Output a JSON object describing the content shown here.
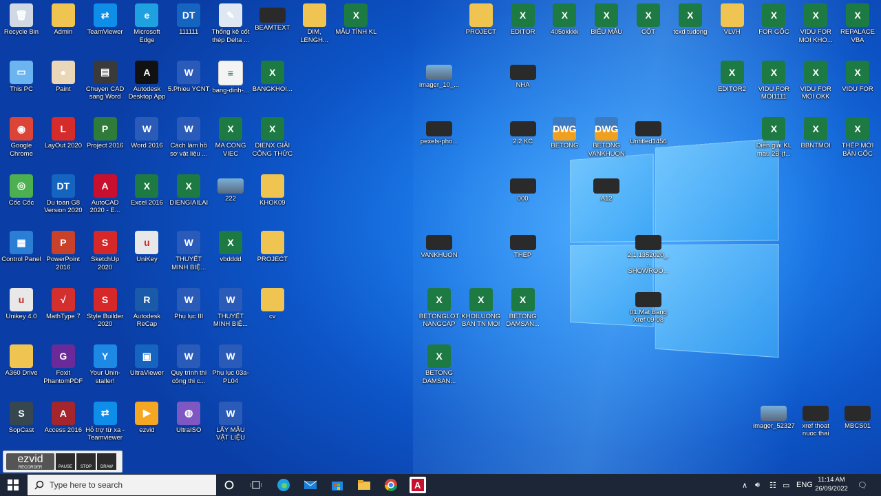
{
  "desktop": {
    "icons": [
      {
        "label": "Recycle Bin",
        "icon": "recycle-bin-icon",
        "col": 0,
        "row": 0
      },
      {
        "label": "Admin",
        "icon": "user-folder-icon",
        "col": 1,
        "row": 0
      },
      {
        "label": "TeamViewer",
        "icon": "teamviewer-icon",
        "col": 2,
        "row": 0
      },
      {
        "label": "Microsoft Edge",
        "icon": "edge-icon",
        "col": 3,
        "row": 0
      },
      {
        "label": "111111",
        "icon": "dutoan-icon",
        "col": 4,
        "row": 0
      },
      {
        "label": "Thống kê cốt thép Delta ...",
        "icon": "pencil-icon",
        "col": 5,
        "row": 0
      },
      {
        "label": "BEAMTEXT",
        "icon": "image-icon",
        "col": 6,
        "row": 0
      },
      {
        "label": "DIM, LENGH...",
        "icon": "text-file-icon",
        "col": 7,
        "row": 0
      },
      {
        "label": "MẪU TÍNH KL",
        "icon": "excel-icon",
        "col": 8,
        "row": 0
      },
      {
        "label": "This PC",
        "icon": "this-pc-icon",
        "col": 0,
        "row": 1
      },
      {
        "label": "Paint",
        "icon": "paint-icon",
        "col": 1,
        "row": 1
      },
      {
        "label": "Chuyen CAD sang Word",
        "icon": "clipboard-icon",
        "col": 2,
        "row": 1
      },
      {
        "label": "Autodesk Desktop App",
        "icon": "autodesk-icon",
        "col": 3,
        "row": 1
      },
      {
        "label": "5.Phieu YCNT",
        "icon": "word-icon",
        "col": 4,
        "row": 1
      },
      {
        "label": "bang-dinh-...",
        "icon": "doc-icon",
        "col": 5,
        "row": 1
      },
      {
        "label": "BANGKHOI...",
        "icon": "excel-icon",
        "col": 6,
        "row": 1
      },
      {
        "label": "Google Chrome",
        "icon": "chrome-icon",
        "col": 0,
        "row": 2
      },
      {
        "label": "LayOut 2020",
        "icon": "layout-icon",
        "col": 1,
        "row": 2
      },
      {
        "label": "Project 2016",
        "icon": "project-icon",
        "col": 2,
        "row": 2
      },
      {
        "label": "Word 2016",
        "icon": "word-icon",
        "col": 3,
        "row": 2
      },
      {
        "label": "Cách làm hồ sơ vật liệu ...",
        "icon": "word-icon",
        "col": 4,
        "row": 2
      },
      {
        "label": "MA CONG VIEC",
        "icon": "excel-icon",
        "col": 5,
        "row": 2
      },
      {
        "label": "DIENX GIẢI CÔNG THỨC",
        "icon": "excel-icon",
        "col": 6,
        "row": 2
      },
      {
        "label": "Cốc Cốc",
        "icon": "coccoc-icon",
        "col": 0,
        "row": 3
      },
      {
        "label": "Du toan G8 Version 2020",
        "icon": "dutoan-icon",
        "col": 1,
        "row": 3
      },
      {
        "label": "AutoCAD 2020 - E...",
        "icon": "autocad-icon",
        "col": 2,
        "row": 3
      },
      {
        "label": "Excel 2016",
        "icon": "excel-icon",
        "col": 3,
        "row": 3
      },
      {
        "label": "DIENGIAILAI",
        "icon": "excel-icon",
        "col": 4,
        "row": 3
      },
      {
        "label": "222",
        "icon": "image-icon",
        "col": 5,
        "row": 3
      },
      {
        "label": "KHOK09",
        "icon": "archive-icon",
        "col": 6,
        "row": 3
      },
      {
        "label": "Control Panel",
        "icon": "control-panel-icon",
        "col": 0,
        "row": 4
      },
      {
        "label": "PowerPoint 2016",
        "icon": "powerpoint-icon",
        "col": 1,
        "row": 4
      },
      {
        "label": "SketchUp 2020",
        "icon": "sketchup-icon",
        "col": 2,
        "row": 4
      },
      {
        "label": "UniKey",
        "icon": "unikey-icon",
        "col": 3,
        "row": 4
      },
      {
        "label": "THUYẾT MINH BIỆ...",
        "icon": "word-icon",
        "col": 4,
        "row": 4
      },
      {
        "label": "vbdddd",
        "icon": "excel-icon",
        "col": 5,
        "row": 4
      },
      {
        "label": "PROJECT",
        "icon": "archive-icon",
        "col": 6,
        "row": 4
      },
      {
        "label": "Unikey 4.0",
        "icon": "unikey-icon",
        "col": 0,
        "row": 5
      },
      {
        "label": "MathType 7",
        "icon": "mathtype-icon",
        "col": 1,
        "row": 5
      },
      {
        "label": "Style Builder 2020",
        "icon": "sketchup-icon",
        "col": 2,
        "row": 5
      },
      {
        "label": "Autodesk ReCap",
        "icon": "recap-icon",
        "col": 3,
        "row": 5
      },
      {
        "label": "Phụ lục III",
        "icon": "word-icon",
        "col": 4,
        "row": 5
      },
      {
        "label": "THUYẾT MINH BIỆ...",
        "icon": "word-icon",
        "col": 5,
        "row": 5
      },
      {
        "label": "cv",
        "icon": "folder-icon",
        "col": 6,
        "row": 5
      },
      {
        "label": "A360 Drive",
        "icon": "folder-icon",
        "col": 0,
        "row": 6
      },
      {
        "label": "Foxit PhantomPDF",
        "icon": "foxit-icon",
        "col": 1,
        "row": 6
      },
      {
        "label": "Your Unin-staller!",
        "icon": "uninstaller-icon",
        "col": 2,
        "row": 6
      },
      {
        "label": "UltraViewer",
        "icon": "ultraviewer-icon",
        "col": 3,
        "row": 6
      },
      {
        "label": "Quy trình thi công thi c...",
        "icon": "word-icon",
        "col": 4,
        "row": 6
      },
      {
        "label": "Phụ lục 03a-PL04",
        "icon": "word-icon",
        "col": 5,
        "row": 6
      },
      {
        "label": "SopCast",
        "icon": "sopcast-icon",
        "col": 0,
        "row": 7
      },
      {
        "label": "Access 2016",
        "icon": "access-icon",
        "col": 1,
        "row": 7
      },
      {
        "label": "Hỗ trợ từ xa - Teamviewer",
        "icon": "teamviewer-icon",
        "col": 2,
        "row": 7
      },
      {
        "label": "ezvid",
        "icon": "ezvid-icon",
        "col": 3,
        "row": 7
      },
      {
        "label": "UltraISO",
        "icon": "disc-icon",
        "col": 4,
        "row": 7
      },
      {
        "label": "LẤY MẪU VẬT LIỆU",
        "icon": "word-icon",
        "col": 5,
        "row": 7
      },
      {
        "label": "imager_10_...",
        "icon": "image-icon",
        "col": 10,
        "row": 1
      },
      {
        "label": "pexels-pho...",
        "icon": "image-icon",
        "col": 10,
        "row": 2
      },
      {
        "label": "VANKHUON",
        "icon": "image-icon",
        "col": 10,
        "row": 4
      },
      {
        "label": "BETONGLOT NANGCAP",
        "icon": "excel-icon",
        "col": 10,
        "row": 5
      },
      {
        "label": "BETONG DAMSAN...",
        "icon": "excel-icon",
        "col": 10,
        "row": 6
      },
      {
        "label": "KHOILUONG BAN TN MOI",
        "icon": "excel-icon",
        "col": 11,
        "row": 5
      },
      {
        "label": "PROJECT",
        "icon": "archive-icon",
        "col": 11,
        "row": 0
      },
      {
        "label": "EDITOR",
        "icon": "excel-icon",
        "col": 12,
        "row": 0
      },
      {
        "label": "NHA",
        "icon": "image-icon",
        "col": 12,
        "row": 1
      },
      {
        "label": "2.2 KC",
        "icon": "image-icon",
        "col": 12,
        "row": 2
      },
      {
        "label": "000",
        "icon": "image-icon",
        "col": 12,
        "row": 3
      },
      {
        "label": "THEP",
        "icon": "image-icon",
        "col": 12,
        "row": 4
      },
      {
        "label": "BETONG DAMSAN...",
        "icon": "excel-icon",
        "col": 12,
        "row": 5
      },
      {
        "label": "405okkkk",
        "icon": "excel-icon",
        "col": 13,
        "row": 0
      },
      {
        "label": "BETONG",
        "icon": "dwg-icon",
        "col": 13,
        "row": 2
      },
      {
        "label": "BIỂU MẪU",
        "icon": "excel-icon",
        "col": 14,
        "row": 0
      },
      {
        "label": "BETONG VANKHUON",
        "icon": "dwg-icon",
        "col": 14,
        "row": 2
      },
      {
        "label": "A12",
        "icon": "image-icon",
        "col": 14,
        "row": 3
      },
      {
        "label": "CỘT",
        "icon": "excel-icon",
        "col": 15,
        "row": 0
      },
      {
        "label": "Untitled1456",
        "icon": "image-icon",
        "col": 15,
        "row": 2
      },
      {
        "label": "2.1.1352020_... SHOWROO...",
        "icon": "image-icon",
        "col": 15,
        "row": 4
      },
      {
        "label": "01.Mat Bang Xref 09-08",
        "icon": "image-icon",
        "col": 15,
        "row": 5
      },
      {
        "label": "tcxd tudong",
        "icon": "excel-icon",
        "col": 16,
        "row": 0
      },
      {
        "label": "VLVH",
        "icon": "text-file-icon",
        "col": 17,
        "row": 0
      },
      {
        "label": "EDITOR2",
        "icon": "excel-icon",
        "col": 17,
        "row": 1
      },
      {
        "label": "FOR GỐC",
        "icon": "excel-icon",
        "col": 18,
        "row": 0
      },
      {
        "label": "VIDU FOR MOI1111",
        "icon": "excel-icon",
        "col": 18,
        "row": 1
      },
      {
        "label": "Diễn giải KL mau 2B (f...",
        "icon": "excel-icon",
        "col": 18,
        "row": 2
      },
      {
        "label": "imager_52327",
        "icon": "image-icon",
        "col": 18,
        "row": 7
      },
      {
        "label": "VIDU FOR MOI KHO...",
        "icon": "excel-icon",
        "col": 19,
        "row": 0
      },
      {
        "label": "VIDU FOR MOI OKK",
        "icon": "excel-icon",
        "col": 19,
        "row": 1
      },
      {
        "label": "BBNTMOI",
        "icon": "excel-icon",
        "col": 19,
        "row": 2
      },
      {
        "label": "xref thoat nuoc thai",
        "icon": "image-icon",
        "col": 19,
        "row": 7
      },
      {
        "label": "REPALACE VBA",
        "icon": "excel-icon",
        "col": 20,
        "row": 0
      },
      {
        "label": "VIDU FOR",
        "icon": "excel-icon",
        "col": 20,
        "row": 1
      },
      {
        "label": "THÉP MỚI BẢN GỐC",
        "icon": "excel-icon",
        "col": 20,
        "row": 2
      },
      {
        "label": "MBCS01",
        "icon": "image-icon",
        "col": 20,
        "row": 7
      }
    ]
  },
  "ezvid": {
    "logo": "ezvid",
    "sub": "RECORDER",
    "pause": "PAUSE",
    "stop": "STOP",
    "draw": "DRAW"
  },
  "taskbar": {
    "search_placeholder": "Type here to search",
    "language": "ENG",
    "time": "11:14 AM",
    "date": "26/09/2022"
  }
}
